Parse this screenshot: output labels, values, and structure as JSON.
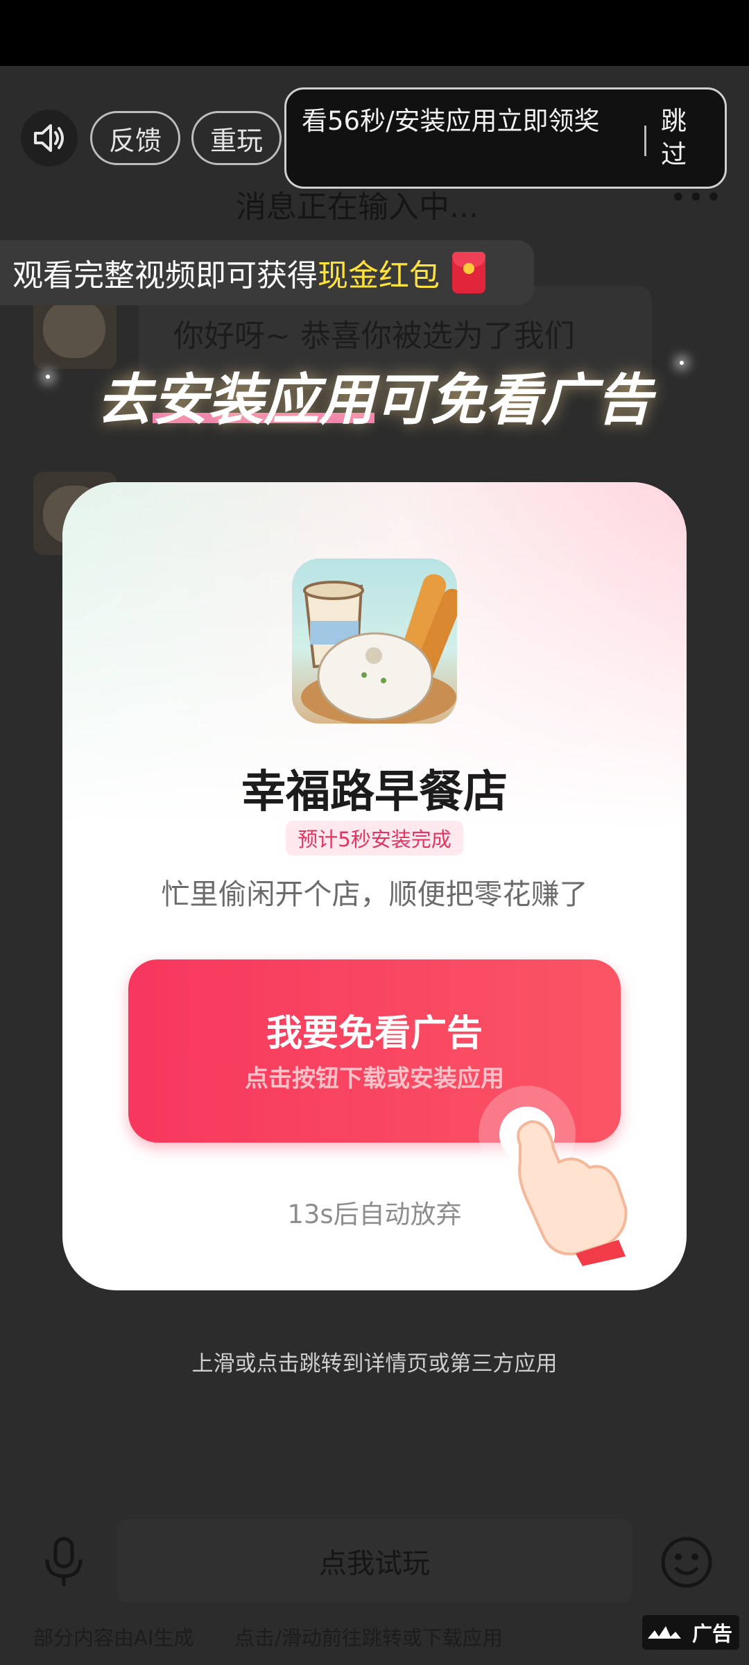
{
  "top": {
    "feedback_label": "反馈",
    "replay_label": "重玩",
    "countdown_text": "看56秒/安装应用立即领奖",
    "skip_label": "跳过"
  },
  "background": {
    "chat_title": "消息正在输入中...",
    "more_dots": "•••",
    "bubble_text": "你好呀~ 恭喜你被选为了我们"
  },
  "reward_banner": {
    "prefix": "观看完整视频即可获得",
    "highlight": "现金红包"
  },
  "headline": {
    "part1": "去",
    "underlined": "安装应用",
    "part2": "可免看广告"
  },
  "card": {
    "app_name": "幸福路早餐店",
    "install_tag": "预计5秒安装完成",
    "description": "忙里偷闲开个店，顺便把零花赚了",
    "cta_main": "我要免看广告",
    "cta_sub": "点击按钮下载或安装应用",
    "auto_quit": "13s后自动放弃"
  },
  "hint": "上滑或点击跳转到详情页或第三方应用",
  "bottom": {
    "try_label": "点我试玩",
    "ai_note": "部分内容由AI生成",
    "go_note": "点击/滑动前往跳转或下载应用",
    "ad_label": "广告"
  },
  "colors": {
    "accent": "#f7375e",
    "highlight_yellow": "#ffe33b",
    "tag_pink": "#e23460"
  },
  "icons": [
    "speaker-icon",
    "red-packet-icon",
    "mic-icon",
    "emoji-icon",
    "pointing-hand-icon",
    "ad-logo-icon"
  ]
}
